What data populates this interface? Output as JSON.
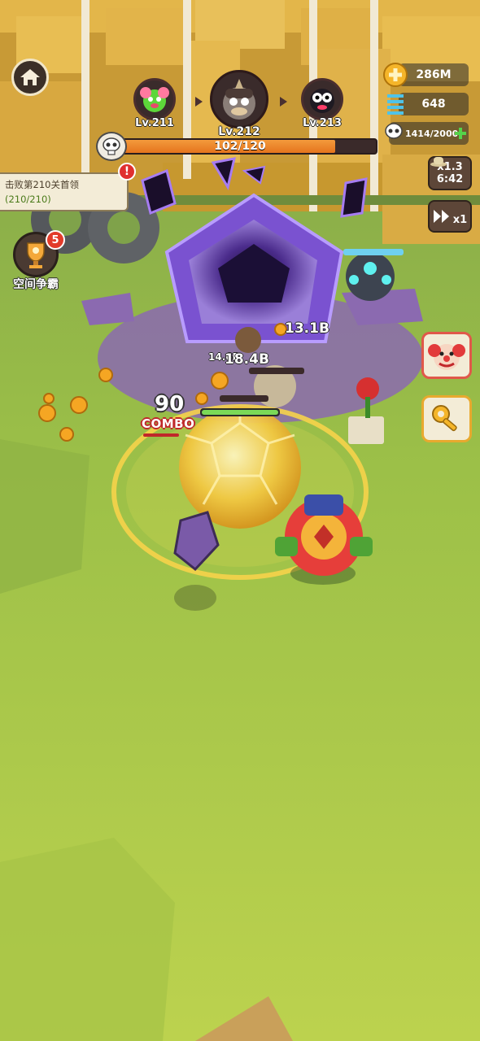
{
  "bosses": [
    {
      "level": "Lv.211"
    },
    {
      "level": "Lv.212"
    },
    {
      "level": "Lv.213"
    }
  ],
  "stage_progress": {
    "text": "102/120",
    "fraction": 0.85
  },
  "resources": {
    "gold": "286M",
    "springs": "648",
    "skulls": "1414/2000"
  },
  "quest": {
    "title": "击败第210关首领",
    "progress": "(210/210)",
    "alert": "!"
  },
  "arena": {
    "label": "空间争霸",
    "badge": "5"
  },
  "speed_controls": {
    "multiplier": "x1.3",
    "timer": "6:42",
    "play_speed": "x1"
  },
  "battle": {
    "damage_numbers": [
      "13.1B",
      "14.6B",
      "18.4B"
    ],
    "combo_count": "90",
    "combo_label": "COMBO"
  },
  "colors": {
    "progress_fill": "#e5741d",
    "grass": "#a9c94a",
    "portal_purple": "#6a3bb8"
  }
}
